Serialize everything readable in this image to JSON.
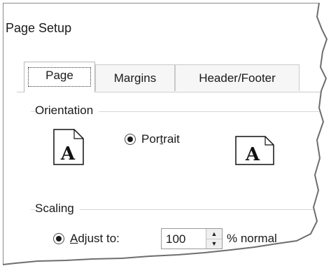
{
  "dialog": {
    "title": "Page Setup"
  },
  "tabs": [
    {
      "label": "Page",
      "active": true
    },
    {
      "label": "Margins",
      "active": false
    },
    {
      "label": "Header/Footer",
      "active": false
    }
  ],
  "orientation": {
    "group_title": "Orientation",
    "portrait_label_pre": "Por",
    "portrait_label_accel": "t",
    "portrait_label_post": "rait",
    "portrait_selected": true,
    "portrait_icon_letter": "A",
    "landscape_icon_letter": "A"
  },
  "scaling": {
    "group_title": "Scaling",
    "adjust_label_accel": "A",
    "adjust_label_rest": "djust to:",
    "adjust_selected": true,
    "value": "100",
    "suffix": "% normal"
  }
}
